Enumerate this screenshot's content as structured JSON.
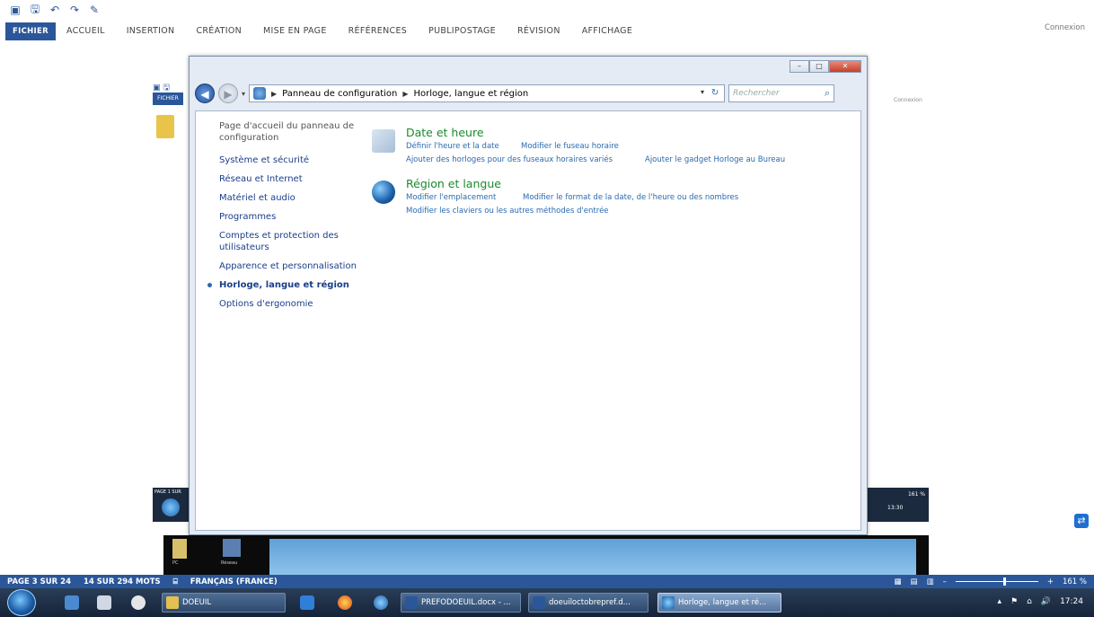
{
  "word": {
    "tabs": [
      "FICHIER",
      "ACCUEIL",
      "INSERTION",
      "CRÉATION",
      "MISE EN PAGE",
      "RÉFÉRENCES",
      "PUBLIPOSTAGE",
      "RÉVISION",
      "AFFICHAGE"
    ],
    "connexion": "Connexion",
    "status": {
      "page": "PAGE 3 SUR 24",
      "words": "14 SUR 294 MOTS",
      "language": "FRANÇAIS (FRANCE)",
      "zoom": "161 %",
      "zoom_fraction": 0.6
    }
  },
  "nested": {
    "fichier": "FICHIER",
    "right_label": "Connexion",
    "status_left": "PAGE 1 SUR",
    "zoom": "161 %",
    "clock": "13:30",
    "desktop_icons": [
      "PC",
      "Réseau"
    ]
  },
  "window": {
    "address": {
      "crumb_root": "Panneau de configuration",
      "crumb_current": "Horloge, langue et région"
    },
    "search_placeholder": "Rechercher",
    "leftnav": {
      "home": "Page d'accueil du panneau de configuration",
      "items": [
        "Système et sécurité",
        "Réseau et Internet",
        "Matériel et audio",
        "Programmes",
        "Comptes et protection des utilisateurs",
        "Apparence et personnalisation",
        "Horloge, langue et région",
        "Options d'ergonomie"
      ]
    },
    "categories": [
      {
        "title": "Date et heure",
        "icon": "calendar-clock-icon",
        "links": [
          "Définir l'heure et la date",
          "Modifier le fuseau horaire",
          "Ajouter des horloges pour des fuseaux horaires variés",
          "Ajouter le gadget Horloge au Bureau"
        ]
      },
      {
        "title": "Région et langue",
        "icon": "globe-icon",
        "links": [
          "Modifier l'emplacement",
          "Modifier le format de la date, de l'heure ou des nombres",
          "Modifier les claviers ou les autres méthodes d'entrée"
        ]
      }
    ]
  },
  "taskbar": {
    "buttons": [
      "DOEUIL",
      "PREFODOEUIL.docx - ...",
      "doeuiloctobrepref.d...",
      "Horloge, langue et ré..."
    ],
    "clock": "17:24"
  },
  "colors": {
    "accent": "#2b579a",
    "link": "#2a6ab0",
    "category_title": "#1b8a2e"
  }
}
